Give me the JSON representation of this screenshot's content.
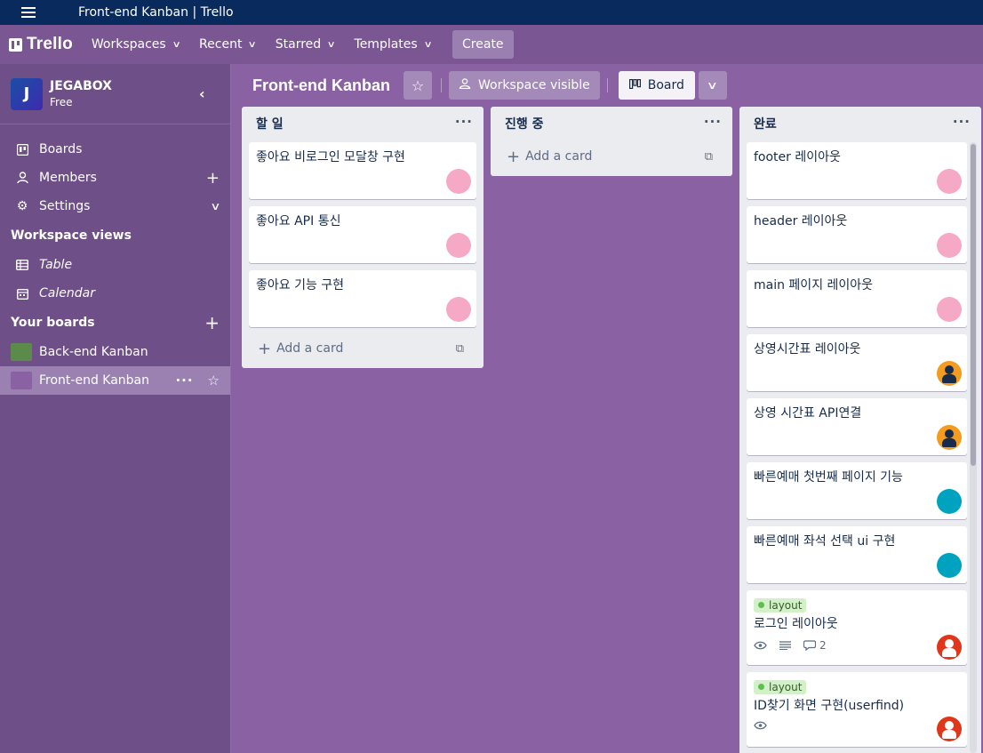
{
  "window": {
    "title": "Front-end Kanban | Trello"
  },
  "header": {
    "logo": "Trello",
    "nav": [
      "Workspaces",
      "Recent",
      "Starred",
      "Templates"
    ],
    "create": "Create"
  },
  "sidebar": {
    "workspace": {
      "initial": "J",
      "name": "JEGABOX",
      "plan": "Free"
    },
    "items": [
      "Boards",
      "Members",
      "Settings"
    ],
    "views_heading": "Workspace views",
    "views": [
      "Table",
      "Calendar"
    ],
    "boards_heading": "Your boards",
    "boards": [
      {
        "name": "Back-end Kanban",
        "color": "#5b8a4a"
      },
      {
        "name": "Front-end Kanban",
        "color": "#8a62a3"
      }
    ]
  },
  "board": {
    "title": "Front-end Kanban",
    "visibility": "Workspace visible",
    "view": "Board"
  },
  "lists": [
    {
      "title": "할 일",
      "cards": [
        {
          "title": "좋아요 비로그인 모달창 구현"
        },
        {
          "title": "좋아요 API 통신"
        },
        {
          "title": "좋아요 기능 구현"
        }
      ],
      "add_card": "Add a card"
    },
    {
      "title": "진행 중",
      "cards": [],
      "add_card": "Add a card"
    },
    {
      "title": "완료",
      "cards": [
        {
          "title": "footer 레이아웃"
        },
        {
          "title": "header 레이아웃"
        },
        {
          "title": "main 페이지 레이아웃"
        },
        {
          "title": "상영시간표 레이아웃"
        },
        {
          "title": "상영 시간표 API연결"
        },
        {
          "title": "빠른예매 첫번째 페이지 기능"
        },
        {
          "title": "빠른예매 좌석 선택 ui 구현"
        },
        {
          "title": "로그인 레이아웃",
          "label": "layout",
          "comments": "2"
        },
        {
          "title": "ID찾기 화면 구현(userfind)",
          "label": "layout"
        }
      ]
    }
  ]
}
